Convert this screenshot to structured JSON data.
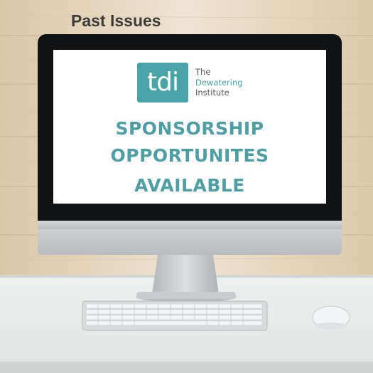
{
  "page": {
    "title": "Past Issues"
  },
  "screen": {
    "logo": {
      "mark": "tdi",
      "line1": "The",
      "line2": "Dewatering",
      "line3": "Institute",
      "color": "#4aa3a6"
    },
    "headline": {
      "line1": "SPONSORSHIP",
      "line2": "OPPORTUNITES",
      "line3": "AVAILABLE",
      "color": "#4f9ea3"
    }
  }
}
